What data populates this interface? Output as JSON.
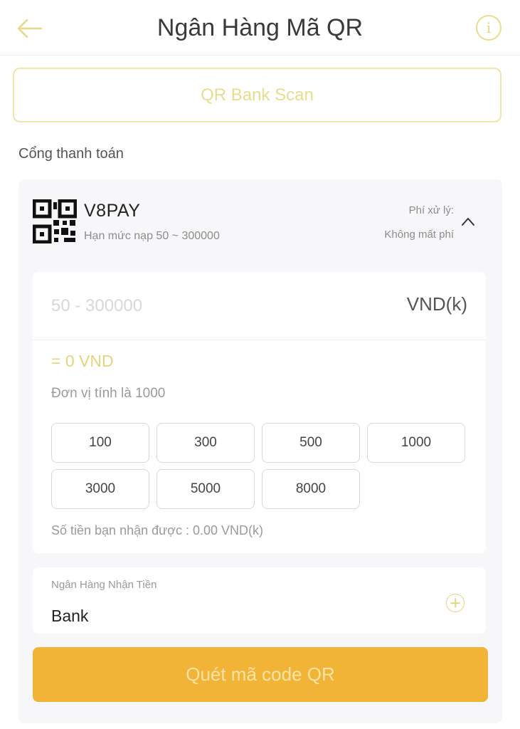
{
  "header": {
    "title": "Ngân Hàng Mã QR",
    "back_icon": "arrow-left-icon",
    "info_icon": "info-icon",
    "info_glyph": "i"
  },
  "scan_button": {
    "label": "QR Bank Scan"
  },
  "section": {
    "label": "Cổng thanh toán"
  },
  "provider": {
    "name": "V8PAY",
    "limit": "Hạn mức nạp 50 ~ 300000",
    "fee_label": "Phí xử lý:",
    "fee_value": "Không mất phí",
    "icon": "qr-code-icon"
  },
  "amount": {
    "placeholder": "50 - 300000",
    "value": "",
    "unit": "VND(k)",
    "converted": "= 0 VND",
    "unit_note": "Đơn vị tính là 1000",
    "quick_amounts": [
      "100",
      "300",
      "500",
      "1000",
      "3000",
      "5000",
      "8000"
    ],
    "receive_note": "Số tiền bạn nhận được : 0.00 VND(k)"
  },
  "bank": {
    "label": "Ngân Hàng Nhận Tiền",
    "value": "Bank",
    "add_icon": "plus-circle-icon"
  },
  "submit": {
    "label": "Quét mã code QR"
  },
  "colors": {
    "accent": "#e3d57c",
    "primary_button": "#f2b437",
    "primary_button_text": "#fbe3a7"
  }
}
